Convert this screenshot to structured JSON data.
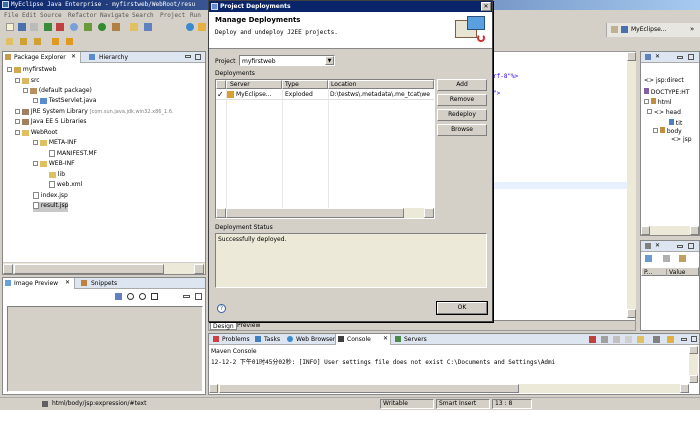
{
  "window": {
    "title": "MyEclipse Java Enterprise - myfirstweb/WebRoot/resu"
  },
  "menu": {
    "items": [
      "File",
      "Edit",
      "Source",
      "Refactor",
      "Navigate",
      "Search",
      "Project",
      "Run"
    ]
  },
  "perspective": {
    "label": "MyEclipse..."
  },
  "package_explorer": {
    "tabs": [
      "Package Explorer",
      "Hierarchy"
    ],
    "tree": [
      {
        "label": "myfirstweb",
        "depth": 0,
        "type": "project"
      },
      {
        "label": "src",
        "depth": 1,
        "type": "folder"
      },
      {
        "label": "(default package)",
        "depth": 2,
        "type": "package"
      },
      {
        "label": "TestServlet.java",
        "depth": 3,
        "type": "java"
      },
      {
        "label": "JRE System Library",
        "extra": "[com.sun.java.jdk.win32.x86_1.6.",
        "depth": 1,
        "type": "lib"
      },
      {
        "label": "Java EE 5 Libraries",
        "depth": 1,
        "type": "lib"
      },
      {
        "label": "WebRoot",
        "depth": 1,
        "type": "folder"
      },
      {
        "label": "META-INF",
        "depth": 2,
        "type": "folder"
      },
      {
        "label": "MANIFEST.MF",
        "depth": 3,
        "type": "file"
      },
      {
        "label": "WEB-INF",
        "depth": 2,
        "type": "folder"
      },
      {
        "label": "lib",
        "depth": 3,
        "type": "folder"
      },
      {
        "label": "web.xml",
        "depth": 3,
        "type": "file"
      },
      {
        "label": "index.jsp",
        "depth": 2,
        "type": "file"
      },
      {
        "label": "result.jsp",
        "depth": 2,
        "type": "file",
        "selected": true
      }
    ]
  },
  "image_preview": {
    "tabs": [
      "Image Preview",
      "Snippets"
    ]
  },
  "editor": {
    "visible_code": [
      "rf-8\"%>",
      "\">"
    ],
    "bottom_tabs": [
      "Design",
      "Preview"
    ]
  },
  "outline": {
    "items": [
      {
        "label": "jsp:direct",
        "depth": 0
      },
      {
        "label": "DOCTYPE:HT",
        "depth": 0
      },
      {
        "label": "html",
        "depth": 0
      },
      {
        "label": "head",
        "depth": 1
      },
      {
        "label": "tit",
        "depth": 2
      },
      {
        "label": "body",
        "depth": 1
      },
      {
        "label": "jsp",
        "depth": 2
      }
    ]
  },
  "properties": {
    "columns": [
      "P...",
      "Value"
    ]
  },
  "console": {
    "tabs": [
      "Problems",
      "Tasks",
      "Web Browser",
      "Console",
      "Servers"
    ],
    "header": "Maven Console",
    "line": "12-12-2 下午01时45分02秒: [INFO] User settings file does not exist C:\\Documents and Settings\\Admi"
  },
  "status_bar": {
    "path": "html/body/jsp:expression/#text",
    "mode": "Writable",
    "insert": "Smart Insert",
    "position": "13 : 8"
  },
  "dialog": {
    "title": "Project Deployments",
    "heading": "Manage Deployments",
    "description": "Deploy and undeploy J2EE projects.",
    "project_label": "Project",
    "project_value": "myfirstweb",
    "deployments_label": "Deployments",
    "columns": [
      "Server",
      "Type",
      "Location"
    ],
    "rows": [
      {
        "server": "MyEclipse...",
        "type": "Exploded",
        "location": "D:\\testws\\.metadata\\.me_tcat\\we"
      }
    ],
    "buttons": {
      "add": "Add",
      "remove": "Remove",
      "redeploy": "Redeploy",
      "browse": "Browse"
    },
    "status_label": "Deployment Status",
    "status_text": "Successfully deployed.",
    "ok": "OK",
    "help": "?"
  },
  "colors": {
    "title_bar": "#0a246a",
    "face": "#d4d0c8",
    "selection": "#316ac5",
    "dialog_header": "#ffffff"
  }
}
